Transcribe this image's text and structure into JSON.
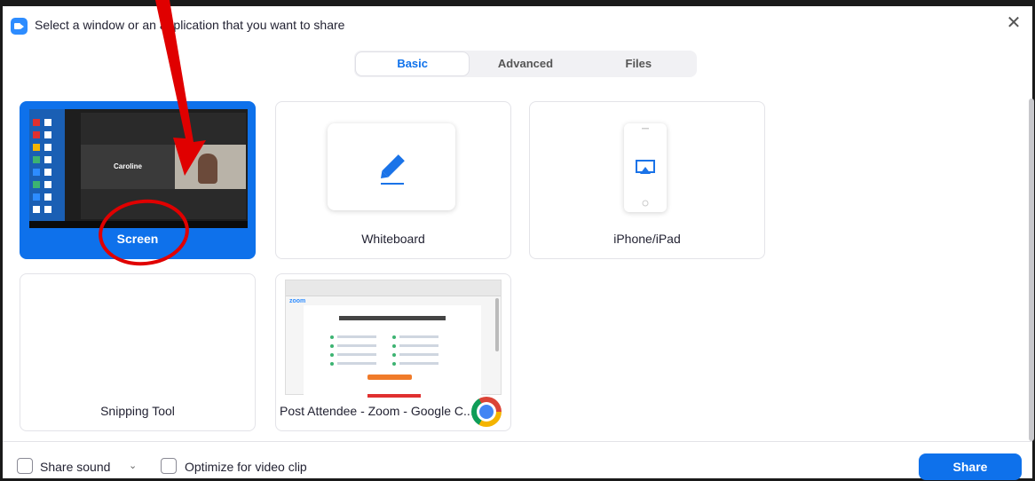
{
  "window": {
    "title": "Select a window or an application that you want to share",
    "close_label": "✕"
  },
  "tabs": [
    {
      "label": "Basic",
      "active": true
    },
    {
      "label": "Advanced",
      "active": false
    },
    {
      "label": "Files",
      "active": false
    }
  ],
  "share_options": [
    {
      "label": "Screen",
      "selected": true,
      "thumbnail_text": "Caroline"
    },
    {
      "label": "Whiteboard",
      "selected": false,
      "icon": "pencil-icon"
    },
    {
      "label": "iPhone/iPad",
      "selected": false,
      "icon": "airplay-icon"
    },
    {
      "label": "Snipping Tool",
      "selected": false
    },
    {
      "label": "Post Attendee - Zoom - Google C...",
      "selected": false,
      "icon": "chrome-icon"
    }
  ],
  "footer": {
    "share_sound_label": "Share sound",
    "share_sound_checked": false,
    "optimize_label": "Optimize for video clip",
    "optimize_checked": false,
    "share_button_label": "Share"
  },
  "colors": {
    "accent": "#0e71eb",
    "annotation": "#e00000"
  },
  "annotations": [
    "red-arrow",
    "red-circle"
  ]
}
